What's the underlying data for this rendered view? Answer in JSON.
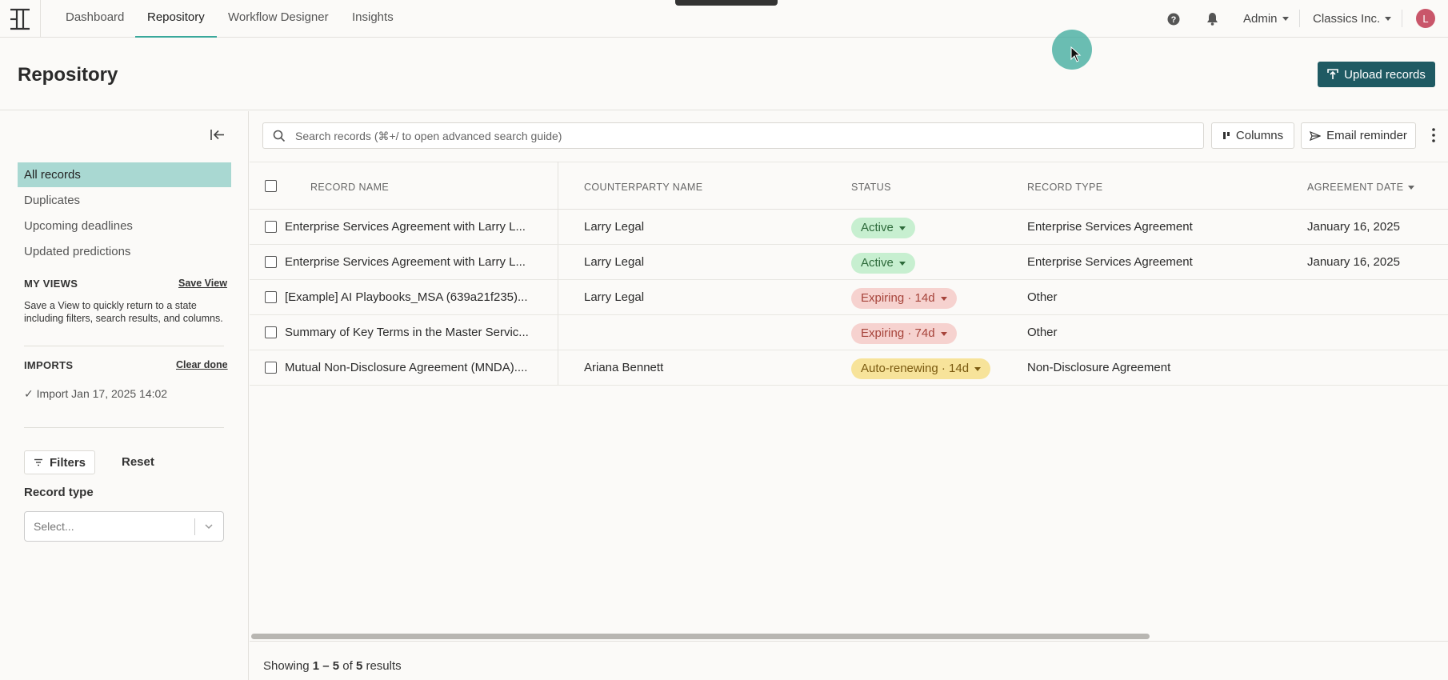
{
  "nav": {
    "tabs": [
      {
        "label": "Dashboard"
      },
      {
        "label": "Repository"
      },
      {
        "label": "Workflow Designer"
      },
      {
        "label": "Insights"
      }
    ],
    "admin_label": "Admin",
    "org_label": "Classics Inc.",
    "avatar_initial": "L",
    "accent_color": "#3aa89b"
  },
  "page": {
    "title": "Repository",
    "upload_label": "Upload records",
    "upload_color": "#1f5a63"
  },
  "sidebar": {
    "items": [
      {
        "label": "All records"
      },
      {
        "label": "Duplicates"
      },
      {
        "label": "Upcoming deadlines"
      },
      {
        "label": "Updated predictions"
      }
    ],
    "my_views": {
      "title": "MY VIEWS",
      "action": "Save View",
      "hint": "Save a View to quickly return to a state including filters, search results, and columns."
    },
    "imports": {
      "title": "IMPORTS",
      "action": "Clear done",
      "item": "✓ Import Jan 17, 2025 14:02"
    },
    "filters_label": "Filters",
    "reset_label": "Reset",
    "record_type_label": "Record type",
    "record_type_placeholder": "Select..."
  },
  "toolbar": {
    "search_placeholder": "Search records (⌘+/ to open advanced search guide)",
    "columns_label": "Columns",
    "email_label": "Email reminder"
  },
  "table": {
    "headers": [
      "RECORD NAME",
      "COUNTERPARTY NAME",
      "STATUS",
      "RECORD TYPE",
      "AGREEMENT DATE"
    ],
    "rows": [
      {
        "name": "Enterprise Services Agreement with Larry L...",
        "counterparty": "Larry Legal",
        "status": "Active",
        "status_tone": "green",
        "type": "Enterprise Services Agreement",
        "date": "January 16, 2025"
      },
      {
        "name": "Enterprise Services Agreement with Larry L...",
        "counterparty": "Larry Legal",
        "status": "Active",
        "status_tone": "green",
        "type": "Enterprise Services Agreement",
        "date": "January 16, 2025"
      },
      {
        "name": "[Example] AI Playbooks_MSA (639a21f235)...",
        "counterparty": "Larry Legal",
        "status": "Expiring · 14d",
        "status_tone": "red",
        "type": "Other",
        "date": ""
      },
      {
        "name": "Summary of Key Terms in the Master Servic...",
        "counterparty": "",
        "status": "Expiring · 74d",
        "status_tone": "red",
        "type": "Other",
        "date": ""
      },
      {
        "name": "Mutual Non-Disclosure Agreement (MNDA)....",
        "counterparty": "Ariana Bennett",
        "status": "Auto-renewing · 14d",
        "status_tone": "yellow",
        "type": "Non-Disclosure Agreement",
        "date": ""
      }
    ]
  },
  "footer": {
    "prefix": "Showing ",
    "range": "1 – 5",
    "of": " of ",
    "total": "5",
    "suffix": " results"
  }
}
